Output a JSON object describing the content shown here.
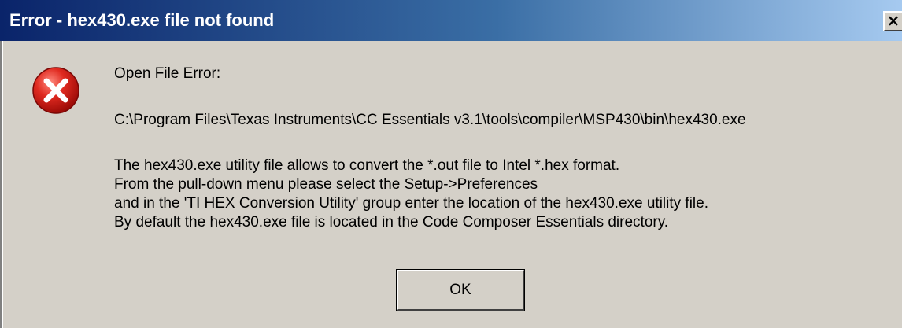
{
  "window": {
    "title": "Error - hex430.exe file not found",
    "close_glyph": "×"
  },
  "colors": {
    "face": "#d4d0c8",
    "title_start": "#0a246a",
    "title_end": "#a6caf0",
    "error_red": "#d42020"
  },
  "icon": {
    "name": "error-icon"
  },
  "message": {
    "heading": "Open File Error:",
    "path": "C:\\Program Files\\Texas Instruments\\CC Essentials v3.1\\tools\\compiler\\MSP430\\bin\\hex430.exe",
    "lines": [
      "The hex430.exe utility file allows to convert the *.out file to Intel *.hex format.",
      "From the pull-down menu please select the Setup->Preferences",
      "and in the 'TI HEX Conversion Utility' group enter the location of the hex430.exe utility file.",
      "By default the hex430.exe file is located in the Code Composer Essentials directory."
    ]
  },
  "buttons": {
    "ok_label": "OK"
  }
}
